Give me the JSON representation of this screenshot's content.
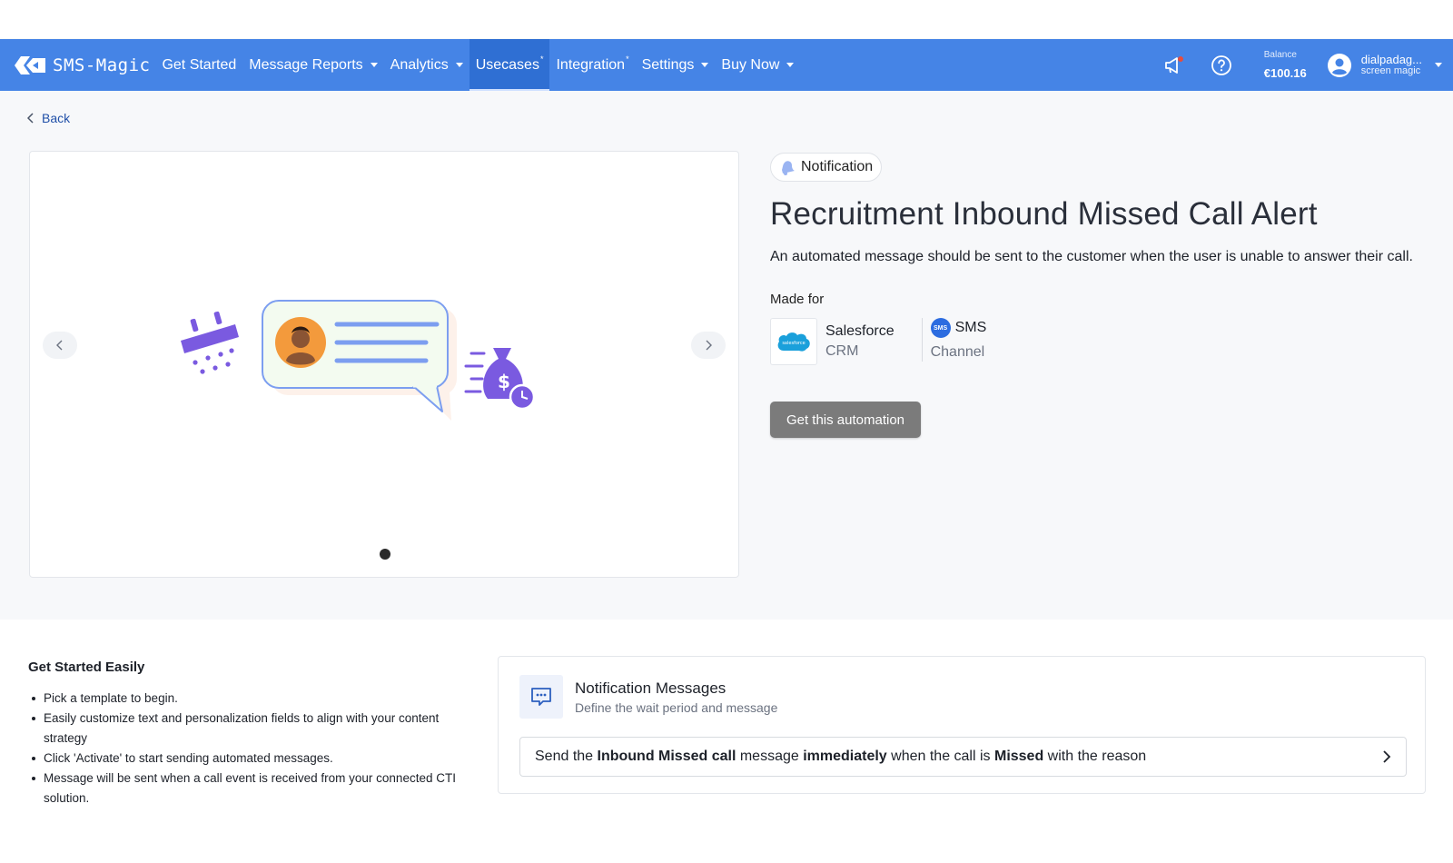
{
  "app": {
    "brand": "SMS-Magic"
  },
  "nav": {
    "items": [
      {
        "label": "Get Started",
        "has_caret": false
      },
      {
        "label": "Message Reports",
        "has_caret": true
      },
      {
        "label": "Analytics",
        "has_caret": true
      },
      {
        "label": "Usecases",
        "marker": "*",
        "active": true
      },
      {
        "label": "Integration",
        "marker": "*"
      },
      {
        "label": "Settings",
        "has_caret": true
      },
      {
        "label": "Buy Now",
        "has_caret": true
      }
    ],
    "right": {
      "announcement_icon": "megaphone-icon",
      "help_icon": "help-circle-icon",
      "balance_label": "Balance",
      "balance_value": "€100.16",
      "user_name": "dialpadag...",
      "user_org": "screen magic"
    }
  },
  "page": {
    "back_label": "Back",
    "badge_label": "Notification",
    "title": "Recruitment Inbound Missed Call Alert",
    "description": "An automated message should be sent to the customer when the user is unable to answer their call.",
    "made_for_label": "Made for",
    "crm": {
      "name": "Salesforce",
      "type": "CRM",
      "logo_text": "salesforce"
    },
    "channel": {
      "name": "SMS",
      "type": "Channel",
      "icon_text": "SMS"
    },
    "cta_label": "Get this automation",
    "carousel": {
      "slide_count": 1,
      "active_slide": 1
    }
  },
  "get_started": {
    "title": "Get Started Easily",
    "bullets": [
      "Pick a template to begin.",
      "Easily customize text and personalization fields to align with your content strategy",
      "Click 'Activate' to start sending automated messages.",
      "Message will be sent when a call event is received from your connected CTI solution."
    ]
  },
  "notification_card": {
    "title": "Notification Messages",
    "subtitle": "Define the wait period and message",
    "row": {
      "t1": "Send the ",
      "b1": "Inbound Missed call",
      "t2": " message ",
      "b2": "immediately",
      "t3": " when the call is ",
      "b3": "Missed",
      "t4": " with the reason"
    }
  },
  "colors": {
    "navbar": "#4584e6",
    "navbar_active": "#2f6fd3",
    "cta": "#7b7b7b",
    "accent_purple": "#7a5ae0"
  }
}
